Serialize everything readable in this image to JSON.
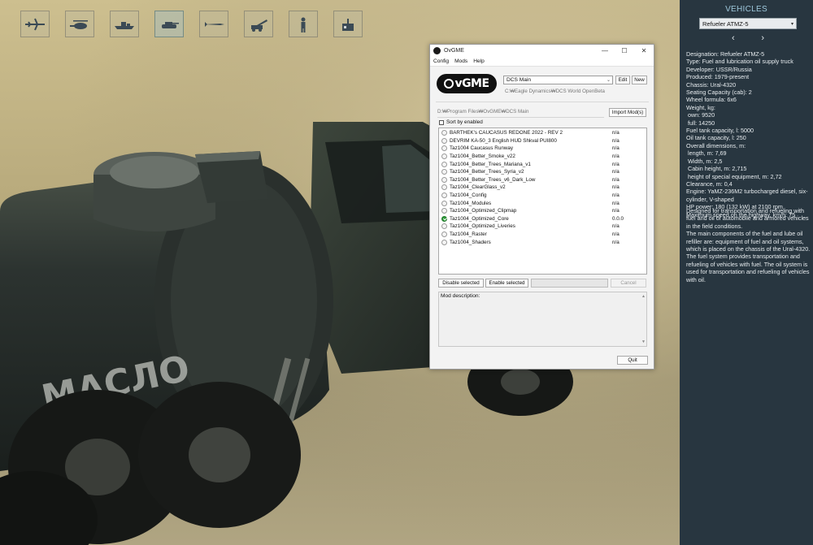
{
  "categories": [
    {
      "icon": "fighter-jet-icon",
      "active": false
    },
    {
      "icon": "helicopter-icon",
      "active": false
    },
    {
      "icon": "ship-icon",
      "active": false
    },
    {
      "icon": "tank-icon",
      "active": true
    },
    {
      "icon": "missile-icon",
      "active": false
    },
    {
      "icon": "artillery-icon",
      "active": false
    },
    {
      "icon": "soldier-icon",
      "active": false
    },
    {
      "icon": "structure-icon",
      "active": false
    }
  ],
  "scene": {
    "tank_lettering": "МАСЛО"
  },
  "vehicles_panel": {
    "title": "VEHICLES",
    "selected_vehicle": "Refueler ATMZ-5",
    "prev_arrow": "‹",
    "next_arrow": "›",
    "specs": [
      "Designation: Refueler ATMZ-5",
      "Type: Fuel and lubrication oil supply truck",
      "Developer: USSR/Russia",
      "Produced: 1979-present",
      "Chassis: Ural-4320",
      "Seating Capacity (cab): 2",
      "Wheel formula: 6x6",
      "Weight, kg:",
      " own: 9520",
      " full: 14250",
      "Fuel tank capacity, l: 5000",
      "Oil tank capacity, l: 250",
      "Overall dimensions, m:",
      " length, m: 7,69",
      " Width, m: 2,5",
      " Cabin height, m: 2,715",
      " height of special equipment, m: 2,72",
      "Clearance, m: 0,4",
      "Engine: YaMZ-236M2 turbocharged diesel, six-",
      "cylinder, V-shaped",
      "HP power: 180 (132 kW) at 2100 rpm",
      "Maximum speed on the highway, km/h: 75"
    ],
    "description": [
      "Designed for transportation and refueling with",
      "fuel and oil of automobile and armored vehicles",
      "in the field conditions.",
      "The main components of the fuel and lube oil",
      "refiller are: equipment of fuel and oil systems,",
      "which is placed on the chassis of the Ural-4320.",
      "The fuel system provides transportation and",
      "refueling of vehicles with fuel. The oil system is",
      "used for transportation and refueling of vehicles",
      "with oil."
    ]
  },
  "ovgme": {
    "title": "OvGME",
    "window_controls": {
      "minimize": "—",
      "maximize": "☐",
      "close": "✕"
    },
    "menu": [
      "Config",
      "Mods",
      "Help"
    ],
    "logo_text": "vGME",
    "config_select": "DCS Main",
    "edit_label": "Edit",
    "new_label": "New",
    "game_path": "C:₩Eagle Dynamics₩DCS World OpenBeta",
    "mods_path": "D:₩Program Files₩OvGME₩DCS Main",
    "import_label": "Import Mod(s)",
    "sort_label": "Sort by enabled",
    "mods": [
      {
        "name": "BARTHEK's CAUCASUS REDONE 2022 - REV 2",
        "version": "n/a",
        "enabled": false
      },
      {
        "name": "DEVRIM KA-50_3 English HUD Shkval PUI800",
        "version": "n/a",
        "enabled": false
      },
      {
        "name": "Taz1004 Caucasus Runway",
        "version": "n/a",
        "enabled": false
      },
      {
        "name": "Taz1004_Better_Smoke_v22",
        "version": "n/a",
        "enabled": false
      },
      {
        "name": "Taz1004_Better_Trees_Mariana_v1",
        "version": "n/a",
        "enabled": false
      },
      {
        "name": "Taz1004_Better_Trees_Syria_v2",
        "version": "n/a",
        "enabled": false
      },
      {
        "name": "Taz1004_Better_Trees_v6_Dark_Low",
        "version": "n/a",
        "enabled": false
      },
      {
        "name": "Taz1004_ClearGlass_v2",
        "version": "n/a",
        "enabled": false
      },
      {
        "name": "Taz1004_Config",
        "version": "n/a",
        "enabled": false
      },
      {
        "name": "Taz1004_Modules",
        "version": "n/a",
        "enabled": false
      },
      {
        "name": "Taz1004_Optimized_Clipmap",
        "version": "n/a",
        "enabled": false
      },
      {
        "name": "Taz1004_Optimized_Core",
        "version": "0.0.0",
        "enabled": true
      },
      {
        "name": "Taz1004_Optimized_Liveries",
        "version": "n/a",
        "enabled": false
      },
      {
        "name": "Taz1004_Raster",
        "version": "n/a",
        "enabled": false
      },
      {
        "name": "Taz1004_Shaders",
        "version": "n/a",
        "enabled": false
      }
    ],
    "disable_label": "Disable selected",
    "enable_label": "Enable selected",
    "cancel_label": "Cancel",
    "mod_description_label": "Mod description:",
    "quit_label": "Quit"
  }
}
